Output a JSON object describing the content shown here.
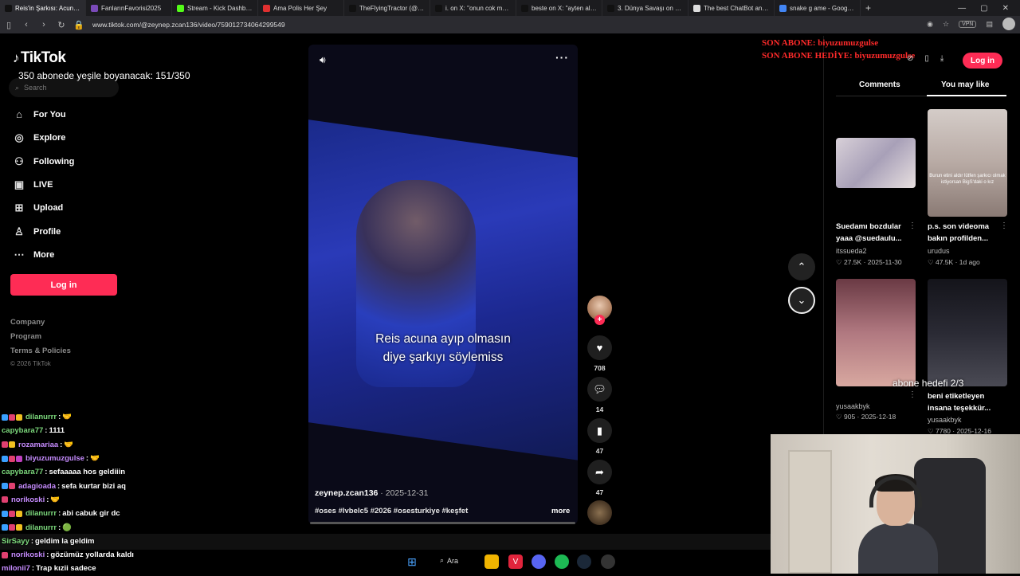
{
  "browser": {
    "tabs": [
      {
        "label": "Reis'in Şarkısı: Acuna Sa",
        "color": "#111111",
        "active": true
      },
      {
        "label": "FanlarınFavorisi2025",
        "color": "#7a4ab8"
      },
      {
        "label": "Stream - Kick Dashboard",
        "color": "#53fc18"
      },
      {
        "label": "Ama Polis Her Şey",
        "color": "#e03030"
      },
      {
        "label": "TheFlyingTractor (@tract",
        "color": "#111111"
      },
      {
        "label": "i. on X: \"onun cok mana",
        "color": "#111111"
      },
      {
        "label": "beste on X: \"ayten alpm",
        "color": "#111111"
      },
      {
        "label": "3. Dünya Savaşı on X: \"",
        "color": "#111111"
      },
      {
        "label": "The best ChatBot and W",
        "color": "#dddddd"
      },
      {
        "label": "snake g ame - Google'd",
        "color": "#4285f4"
      }
    ],
    "new_tab": "+",
    "url": "www.tiktok.com/@zeynep.zcan136/video/759012734064299549",
    "vpn": "VPN"
  },
  "tiktok": {
    "logo": "TikTok",
    "search_placeholder": "Search",
    "nav": [
      {
        "label": "For You",
        "icon": "home-icon",
        "glyph": "⌂"
      },
      {
        "label": "Explore",
        "icon": "compass-icon",
        "glyph": "◎"
      },
      {
        "label": "Following",
        "icon": "following-icon",
        "glyph": "⚇"
      },
      {
        "label": "LIVE",
        "icon": "live-icon",
        "glyph": "▣"
      },
      {
        "label": "Upload",
        "icon": "upload-icon",
        "glyph": "⊞"
      },
      {
        "label": "Profile",
        "icon": "profile-icon",
        "glyph": "♙"
      },
      {
        "label": "More",
        "icon": "more-icon",
        "glyph": "⋯"
      }
    ],
    "login": "Log in",
    "footer": [
      "Company",
      "Program",
      "Terms & Policies"
    ],
    "copyright": "© 2026 TikTok"
  },
  "stream_overlay": {
    "goal": "350 abonede yeşile boyanacak: 151/350",
    "last_sub": "SON ABONE: biyuzumuzgulse",
    "last_gift": "SON ABONE HEDİYE: biyuzumuzgulse",
    "sub_goal": "abone hedefi 2/3"
  },
  "video": {
    "subtitle_line1": "Reis acuna ayıp olmasın",
    "subtitle_line2": "diye şarkıyı söylemiss",
    "author": "zeynep.zcan136",
    "date": "2025-12-31",
    "hashtags": "#oses #lvbelc5 #2026 #osesturkiye #keşfet",
    "more": "more",
    "likes": "708",
    "comments": "14",
    "saves": "47",
    "shares": "47"
  },
  "right_panel": {
    "login": "Log in",
    "tab_comments": "Comments",
    "tab_you_may_like": "You may like",
    "cards": [
      {
        "title": "Suedamı bozdular yaaa @suedaulu...",
        "user": "itssueda2",
        "likes": "27.5K",
        "date": "2025-11-30"
      },
      {
        "title": "p.s. son videoma bakın profilden...",
        "user": "urudus",
        "likes": "47.5K",
        "date": "1d ago",
        "thumb_caption": "Burun etini aldır lütfen şarkıcı olmak istiyorsan BigS'daki o kız"
      },
      {
        "title": "",
        "user": "yusaakbyk",
        "likes": "905",
        "date": "2025-12-18"
      },
      {
        "title": "beni etiketleyen insana teşekkür...",
        "user": "yusaakbyk",
        "likes": "7780",
        "date": "2025-12-16"
      }
    ]
  },
  "chat": [
    {
      "user": "dilanurrr",
      "color": "#7cd97c",
      "msg": "🤝",
      "badges": [
        "#3aa0ff",
        "#e04070",
        "#f0c020"
      ]
    },
    {
      "user": "capybara77",
      "color": "#7cd97c",
      "msg": "1111",
      "badges": []
    },
    {
      "user": "rozamariaa",
      "color": "#c78cff",
      "msg": "🤝",
      "badges": [
        "#e04070",
        "#f0c020"
      ]
    },
    {
      "user": "biyuzumuzgulse",
      "color": "#c78cff",
      "msg": "🤝",
      "badges": [
        "#3aa0ff",
        "#e04070",
        "#c040c0"
      ]
    },
    {
      "user": "capybara77",
      "color": "#7cd97c",
      "msg": "sefaaaaa hos geldiiin",
      "badges": []
    },
    {
      "user": "adagioada",
      "color": "#c78cff",
      "msg": "sefa kurtar bizi aq",
      "badges": [
        "#3aa0ff",
        "#e04070"
      ]
    },
    {
      "user": "norikoski",
      "color": "#c78cff",
      "msg": "🤝",
      "badges": [
        "#e04070"
      ]
    },
    {
      "user": "dilanurrr",
      "color": "#7cd97c",
      "msg": "abi cabuk gir dc",
      "badges": [
        "#3aa0ff",
        "#e04070",
        "#f0c020"
      ]
    },
    {
      "user": "dilanurrr",
      "color": "#7cd97c",
      "msg": "🟢",
      "badges": [
        "#3aa0ff",
        "#e04070",
        "#f0c020"
      ]
    },
    {
      "user": "SirSayy",
      "color": "#7cd97c",
      "msg": "geldim la geldim",
      "badges": []
    },
    {
      "user": "norikoski",
      "color": "#c78cff",
      "msg": "gözümüz yollarda kaldı",
      "badges": [
        "#e04070"
      ]
    },
    {
      "user": "milonii7",
      "color": "#c78cff",
      "msg": "Trap kızii sadece",
      "badges": []
    }
  ],
  "taskbar": {
    "search": "Ara"
  }
}
